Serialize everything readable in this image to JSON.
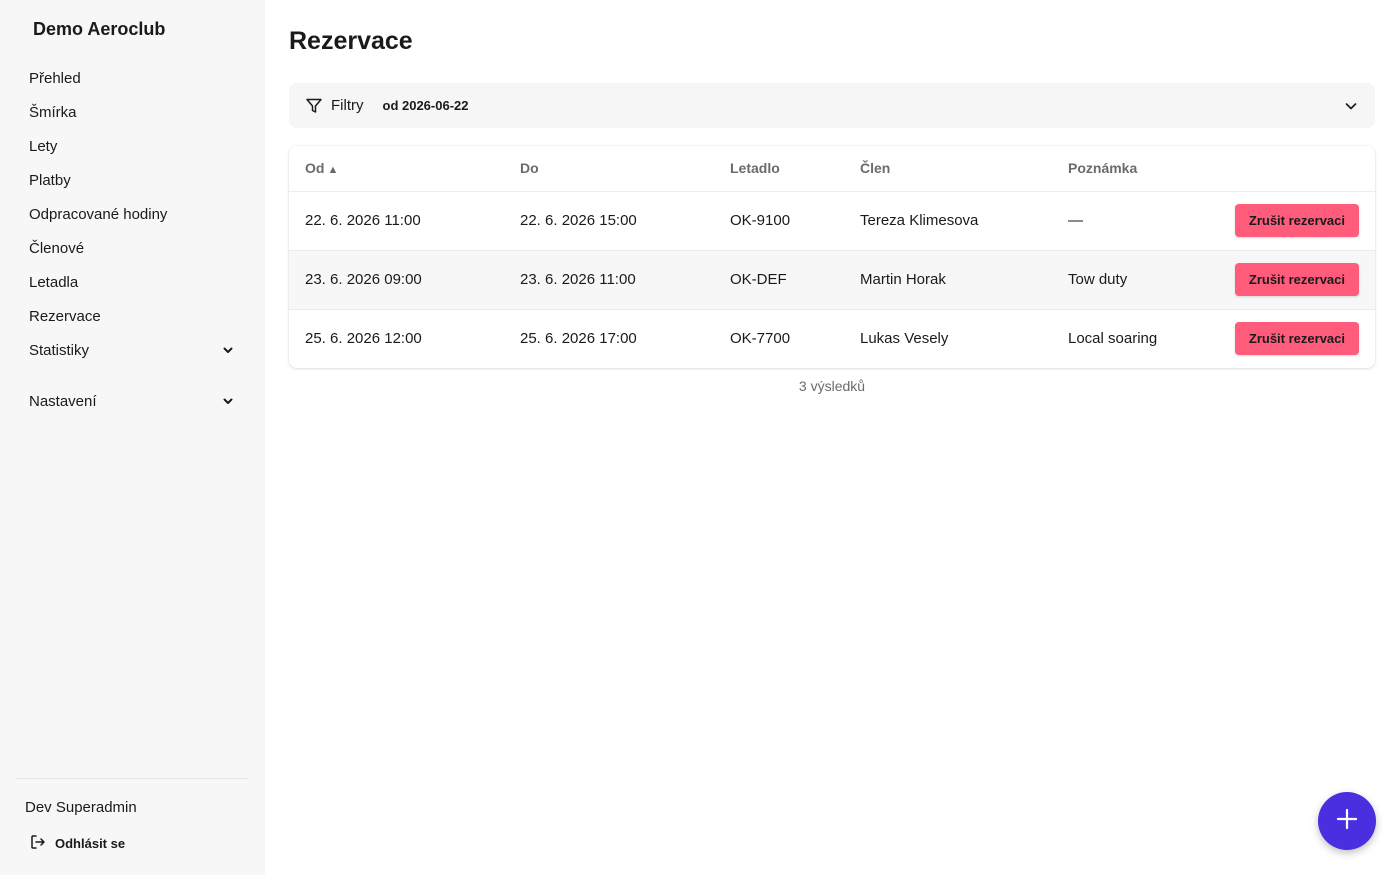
{
  "sidebar": {
    "brand": "Demo Aeroclub",
    "items": [
      {
        "label": "Přehled"
      },
      {
        "label": "Šmírka"
      },
      {
        "label": "Lety"
      },
      {
        "label": "Platby"
      },
      {
        "label": "Odpracované hodiny"
      },
      {
        "label": "Členové"
      },
      {
        "label": "Letadla"
      },
      {
        "label": "Rezervace"
      }
    ],
    "groups": [
      {
        "label": "Statistiky",
        "icon": "chevron-down-icon"
      },
      {
        "label": "Nastavení",
        "icon": "chevron-down-icon"
      }
    ],
    "user_name": "Dev Superadmin",
    "logout_label": "Odhlásit se"
  },
  "main": {
    "title": "Rezervace",
    "filters": {
      "label": "Filtry",
      "summary": "od 2026-06-22"
    },
    "table": {
      "columns": [
        {
          "label": "Od",
          "sort": "▲"
        },
        {
          "label": "Do"
        },
        {
          "label": "Letadlo"
        },
        {
          "label": "Člen"
        },
        {
          "label": "Poznámka"
        }
      ],
      "rows": [
        {
          "od": "22. 6. 2026 11:00",
          "do": "22. 6. 2026 15:00",
          "letadlo": "OK-9100",
          "clen": "Tereza Klimesova",
          "poznamka": "—",
          "action": "Zrušit rezervaci"
        },
        {
          "od": "23. 6. 2026 09:00",
          "do": "23. 6. 2026 11:00",
          "letadlo": "OK-DEF",
          "clen": "Martin Horak",
          "poznamka": "Tow duty",
          "action": "Zrušit rezervaci"
        },
        {
          "od": "25. 6. 2026 12:00",
          "do": "25. 6. 2026 17:00",
          "letadlo": "OK-7700",
          "clen": "Lukas Vesely",
          "poznamka": "Local soaring",
          "action": "Zrušit rezervaci"
        }
      ]
    },
    "results": "3 výsledků"
  },
  "colors": {
    "accent": "#4a2fe0",
    "danger": "#ff5c7c",
    "sidebar_bg": "#f7f7f7"
  },
  "icons": {
    "filter": "filter-icon",
    "logout": "logout-icon",
    "fab": "plus-icon",
    "expand": "chevron-down-icon"
  }
}
